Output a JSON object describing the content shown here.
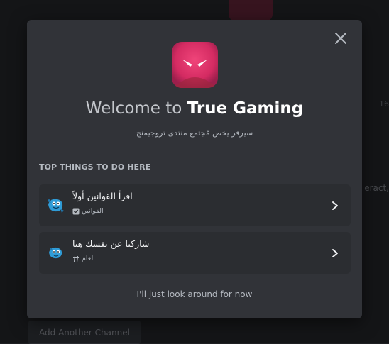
{
  "background": {
    "side_text_1": "16",
    "side_text_2": "eract, ",
    "add_channel_button": "Add Another Channel"
  },
  "modal": {
    "title_prefix": "Welcome to ",
    "server_name": "True Gaming",
    "description": "سيرفر يخص مُجتمع منتدى تروجيمنج",
    "section_heading": "TOP THINGS TO DO HERE",
    "tasks": [
      {
        "title": "اقرأ القوانين أولاً",
        "channel": "القوانين",
        "channel_icon": "rules-check-icon",
        "emoji": "blue-creature-icon"
      },
      {
        "title": "شاركنا عن نفسك هنا",
        "channel": "العام",
        "channel_icon": "hashtag-icon",
        "emoji": "blue-creature-icon"
      }
    ],
    "skip_label": "I'll just look around for now"
  },
  "colors": {
    "modal_bg": "#313338",
    "card_bg": "#2b2d31",
    "server_icon_bg": "#e0336a",
    "emoji_blue": "#2f9bd6"
  }
}
